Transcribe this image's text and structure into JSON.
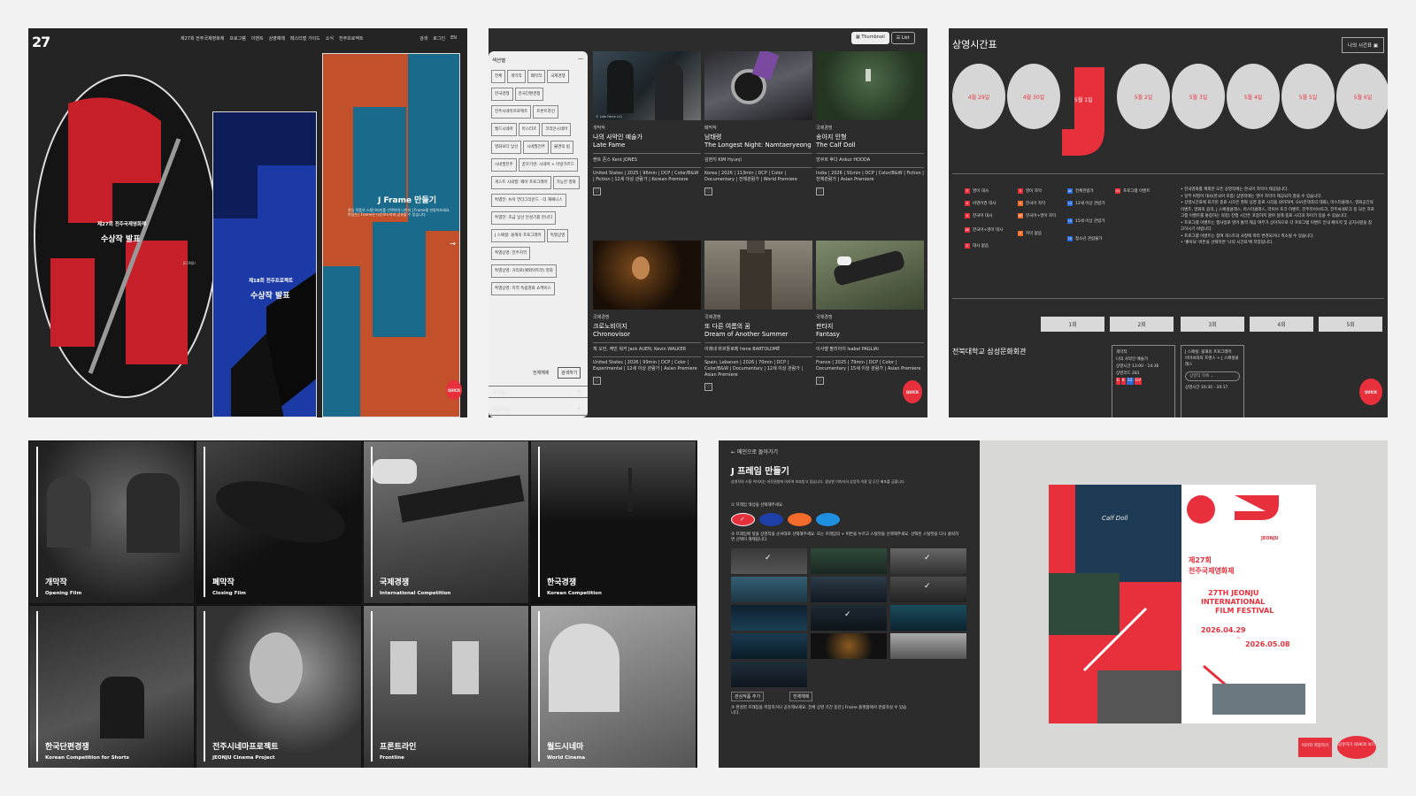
{
  "p1": {
    "logo": "27",
    "nav": [
      "제27회 전주국제영화제",
      "프로그램",
      "이벤트",
      "상영예매",
      "페스티벌 가이드",
      "소식",
      "전주프로젝트"
    ],
    "nav_right": [
      "검색",
      "로그인",
      "EN"
    ],
    "poster1_title": "제27회 전주국제영화제",
    "poster1_sub": "수상작 발표",
    "poster1_badge": "JEONJU",
    "poster2_title": "제18회 전주프로젝트",
    "poster2_sub": "수상작 발표",
    "poster3_title": "J Frame 만들기",
    "poster3_desc": "관심 작품의 스틸이미지를 선택하여 나만의 J Frame을 만들어보세요. 완성된 J Frame은 다운로드하여 공유할 수 있습니다.",
    "quick": "QUICK",
    "arrow": "→"
  },
  "p2": {
    "toggle_thumb": "Thumbnail",
    "toggle_list": "List",
    "side_title": "섹션별",
    "side_minus": "—",
    "tags": [
      "전체",
      "개막작",
      "폐막작",
      "국제경쟁",
      "한국경쟁",
      "한국단편경쟁",
      "전주시네마프로젝트",
      "프론트라인",
      "월드시네마",
      "마스터즈",
      "코리안시네마",
      "영화보다 낯선",
      "시네필전주",
      "불면의 밤",
      "시네필전주",
      "꿈꾸기란: 시네마 + 아방가르드",
      "게스트 시네필: 페어 프로그래머",
      "가능한 영화",
      "특별전: 뉴욕 언더그라운드 - 더 재패니스",
      "특별전: 조금 낯선 안성기를 만나다",
      "J 스페셜: 올해의 프로그래머",
      "특별상영",
      "특별상영: 전주지역",
      "특별상영: 거리로(예외아트라) 영화",
      "특별상영: 지역 독립영화 쇼케이스"
    ],
    "side_reset": "전체해제",
    "side_apply": "검색하기",
    "side_country": "국가별",
    "side_next": "러닝타임",
    "plus": "+",
    "cards": [
      {
        "cat": "개막작",
        "ko": "나의 사악인 예술가",
        "en": "Late Fame",
        "dir": "켄트 존스 Kent JONES",
        "meta": "United States | 2025 | 96min | DCP | Color/B&W | Fiction | 12세 이상 관람가 | Korean Premiere",
        "credit": "© Late Fame LLC"
      },
      {
        "cat": "폐막작",
        "ko": "남태령",
        "en": "The Longest Night: Namtaeryeong",
        "dir": "김현지 KIM Hyunji",
        "meta": "Korea | 2026 | 113min | DCP | Color | Documentary | 전체관람가 | World Premiere",
        "credit": ""
      },
      {
        "cat": "국제경쟁",
        "ko": "송아지 인형",
        "en": "The Calf Doll",
        "dir": "앙쿠르 후다 Ankur HOODA",
        "meta": "India | 2026 | 91min | DCP | Color/B&W | Fiction | 전체관람가 | Asian Premiere",
        "credit": ""
      },
      {
        "cat": "국제경쟁",
        "ko": "크로노비이지",
        "en": "Chronovisor",
        "dir": "잭 오언, 케빈 워커 Jack AUEN, Kevin WALKER",
        "meta": "United States | 2026 | 99min | DCP | Color | Experimental | 12세 이상 관람가 | Asian Premiere",
        "credit": ""
      },
      {
        "cat": "국제경쟁",
        "ko": "또 다른 여름의 꿈",
        "en": "Dream of Another Summer",
        "dir": "이레네 바르톨로메 Irene BARTOLOMÉ",
        "meta": "Spain, Lebanon | 2026 | 70min | DCP | Color/B&W | Documentary | 12세 이상 관람가 | Asian Premiere",
        "credit": ""
      },
      {
        "cat": "국제경쟁",
        "ko": "판타지",
        "en": "Fantasy",
        "dir": "이사벨 팔리아이 Isabel PAGLIAI",
        "meta": "France | 2025 | 79min | DCP | Color | Documentary | 15세 이상 관람가 | Asian Premiere",
        "credit": ""
      }
    ],
    "heart": "♡",
    "quick": "QUICK"
  },
  "p3": {
    "title": "상영시간표",
    "my_schedule": "나의 시간표",
    "days": [
      "4월 29일",
      "4월 30일",
      "5월 1일",
      "5월 2일",
      "5월 3일",
      "5월 4일",
      "5월 5일",
      "5월 6일"
    ],
    "legend": [
      {
        "icon": "E",
        "label": "영어 대사"
      },
      {
        "icon": "E",
        "label": "영어 자막"
      },
      {
        "icon": "All",
        "label": "전체관람가"
      },
      {
        "icon": "GV",
        "label": "프로그램 이벤트"
      },
      {
        "icon": "K",
        "label": "비영어권 대사"
      },
      {
        "icon": "K",
        "label": "한국어 자막"
      },
      {
        "icon": "12",
        "label": "12세 이상 관람가"
      },
      {
        "icon": "K",
        "label": "한국어 대사"
      },
      {
        "icon": "KE",
        "label": "한국어+영어 자막"
      },
      {
        "icon": "15",
        "label": "15세 이상 관람가"
      },
      {
        "icon": "KE",
        "label": "한국어+영어 대사"
      },
      {
        "icon": "R",
        "label": "자막 없음"
      },
      {
        "icon": "19",
        "label": "청소년 관람불가"
      },
      {
        "icon": "E",
        "label": "대사 없음"
      }
    ],
    "notes": [
      "• 한국영화를 제외한 모든 상영작에는 한국어 자막이 제공됩니다.",
      "• 일부 비영어 대사(한국어 포함) 상영작에는 영어 자막이 제공되지 않을 수 있습니다.",
      "• 상영시간표에 표기된 종료 시각은 영화 상영 종료 시각을 의미하며, GV(관객과의 대화), 마스터클래스, 영화공간의 이벤트, 영화의 음악, J 스페셜클래스, 마스터클래스, 라이브 토크 이벤트, 전주라이브토크, 전주씨네토크 등 모든 프로그램 이벤트를 통칭하는 약칭) 진행 시간은 포함하지 않아 실제 종료 시각과 차이가 있을 수 있습니다.",
      "• 프로그램 이벤트는 행사일로 영어 통역 제공 여부가 상이하므로 각 프로그램 이벤트 안내 페이지 및 공지사항을 참고하시기 바랍니다.",
      "• 프로그램 이벤트는 참여 게스트의 사정에 따라 변경되거나 취소될 수 있습니다.",
      "• '좋아요' 버튼을 선택하면 '나의 시간표'에 저장됩니다."
    ],
    "rounds": [
      "1회",
      "2회",
      "3회",
      "4회",
      "5회"
    ],
    "venue": "전북대학교 삼성문화회관",
    "s1_title": "개막작",
    "s1_film": "나의 사악인 예술가",
    "s1_time_label": "상영시간",
    "s1_time": "13:00 - 14:36",
    "s1_code_label": "상영코드",
    "s1_code": "281",
    "s1_badges": [
      "E",
      "K",
      "12",
      "GV"
    ],
    "s2_title": "J 스페셜: 올해의 프로그래머",
    "s2_film": "아마씨와의 프랜스 + J 스페셜클래스",
    "s2_select": "상영작 목록",
    "s2_time_label": "상영시간",
    "s2_time": "16:30 - 20:17",
    "quick": "QUICK"
  },
  "p4": {
    "tiles": [
      {
        "ko": "개막작",
        "en": "Opening Film"
      },
      {
        "ko": "폐막작",
        "en": "Closing Film"
      },
      {
        "ko": "국제경쟁",
        "en": "International Competition"
      },
      {
        "ko": "한국경쟁",
        "en": "Korean Competition"
      },
      {
        "ko": "한국단편경쟁",
        "en": "Korean Competition for Shorts"
      },
      {
        "ko": "전주시네마프로젝트",
        "en": "JEONJU Cinema Project"
      },
      {
        "ko": "프론트라인",
        "en": "Frontline"
      },
      {
        "ko": "월드시네마",
        "en": "World Cinema"
      }
    ]
  },
  "p5": {
    "back": "← 메인으로 돌아가기",
    "title": "J 프레임 만들기",
    "desc": "상영작의 스틸 이미지는 저작권법에 의하여 보호받고 있습니다. 생성한 이미지의 상업적 이용 및 무단 배포를 금합니다.",
    "step1": "① 프레임 색상을 선택해주세요.",
    "step2": "② 프레임에 넣을 상영작을 순서대로 선택해주세요. 또는 프레임의 + 버튼을 누르고 스틸컷을 선택해주세요. 선택된 스틸컷을 다시 클릭하면 선택이 해제됩니다.",
    "add_btn": "관심작품 추가",
    "reset_btn": "전체해제",
    "step3": "③ 완성된 프레임을 저장하거나 공유해보세요. 전체 상영 기간 동안 J Frame 플랫폼에서 관람하실 수 있습니다.",
    "swatches": [
      "#e8303d",
      "#1f3fa8",
      "#f26b2b",
      "#1f8fe0"
    ],
    "poster_calf": "Calf Doll",
    "poster_logo": "JEONJU",
    "poster_ko1": "제27회",
    "poster_ko2": "전주국제영화제",
    "poster_en1": "27TH JEONJU",
    "poster_en2": "INTERNATIONAL",
    "poster_en3": "FILM FESTIVAL",
    "date_start": "2026.04.29",
    "date_sep": "~",
    "date_end": "2026.05.08",
    "save_btn": "이미지 저장하기",
    "share_btn": "공유하기 QUICK 보기"
  }
}
